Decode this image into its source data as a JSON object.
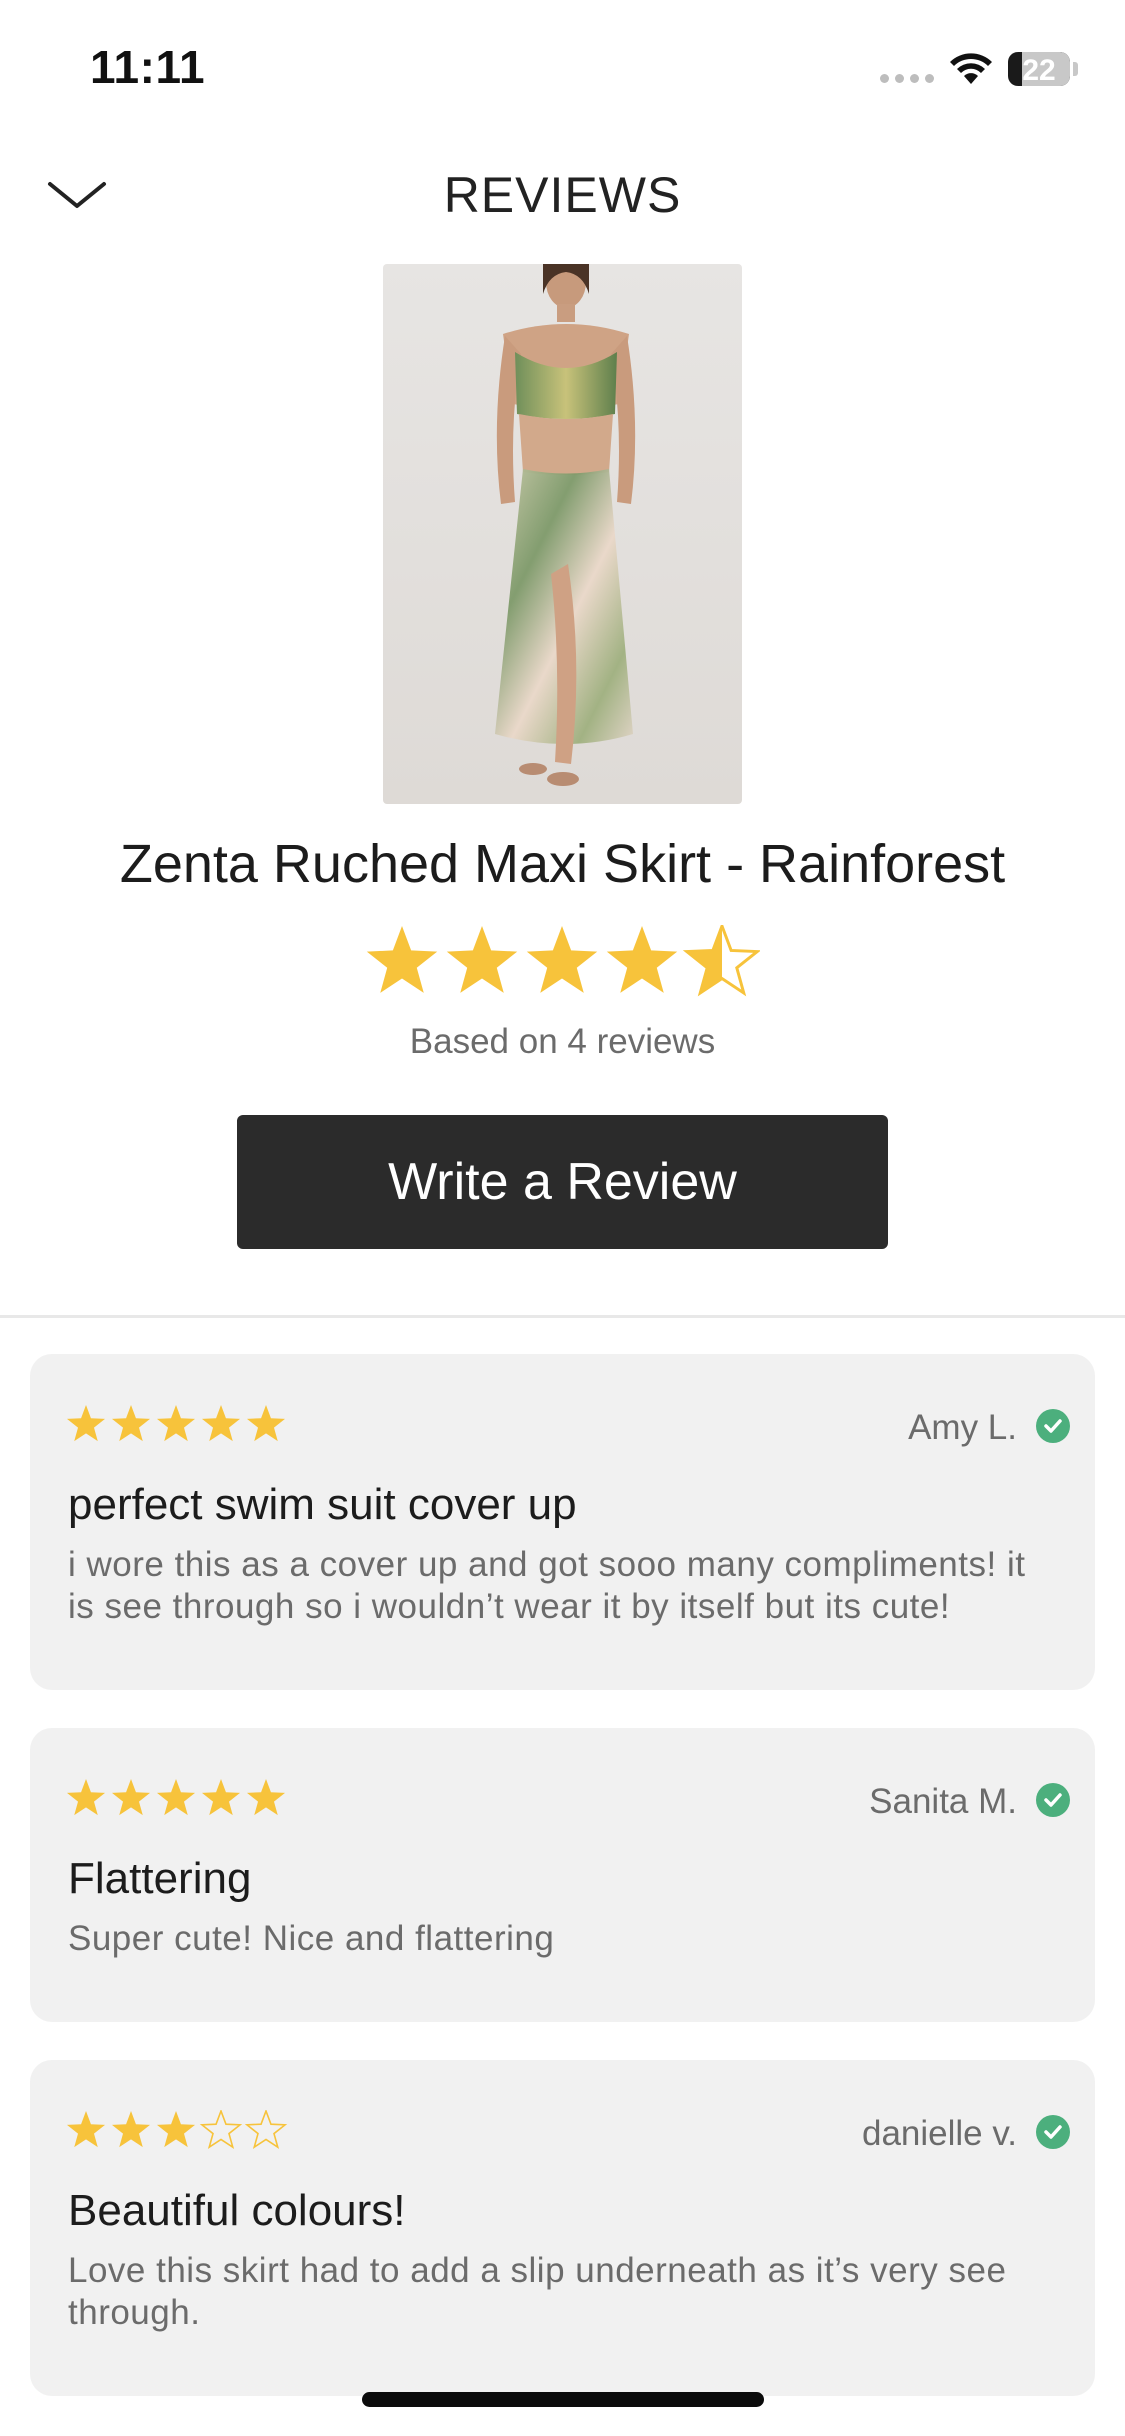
{
  "status": {
    "time": "11:11",
    "battery": "22"
  },
  "header": {
    "title": "REVIEWS"
  },
  "product": {
    "name": "Zenta Ruched Maxi Skirt - Rainforest",
    "rating": 4.5,
    "max_rating": 5,
    "reviews_count_text": "Based on 4 reviews"
  },
  "actions": {
    "write_review_label": "Write a Review"
  },
  "colors": {
    "star": "#f7c33b",
    "verified": "#4caf7d",
    "button_bg": "#2b2b2b",
    "card_bg": "#f1f1f1"
  },
  "reviews": [
    {
      "author": "Amy L.",
      "rating": 5,
      "verified": true,
      "title": "perfect swim suit cover up",
      "body": "i wore this as a cover up and got sooo many compliments! it is see through so i wouldn’t wear it by itself but its cute!"
    },
    {
      "author": "Sanita M.",
      "rating": 5,
      "verified": true,
      "title": "Flattering",
      "body": "Super cute! Nice and flattering"
    },
    {
      "author": "danielle v.",
      "rating": 3,
      "verified": true,
      "title": "Beautiful colours!",
      "body": "Love this skirt had to add a slip underneath as it’s very see through."
    }
  ]
}
